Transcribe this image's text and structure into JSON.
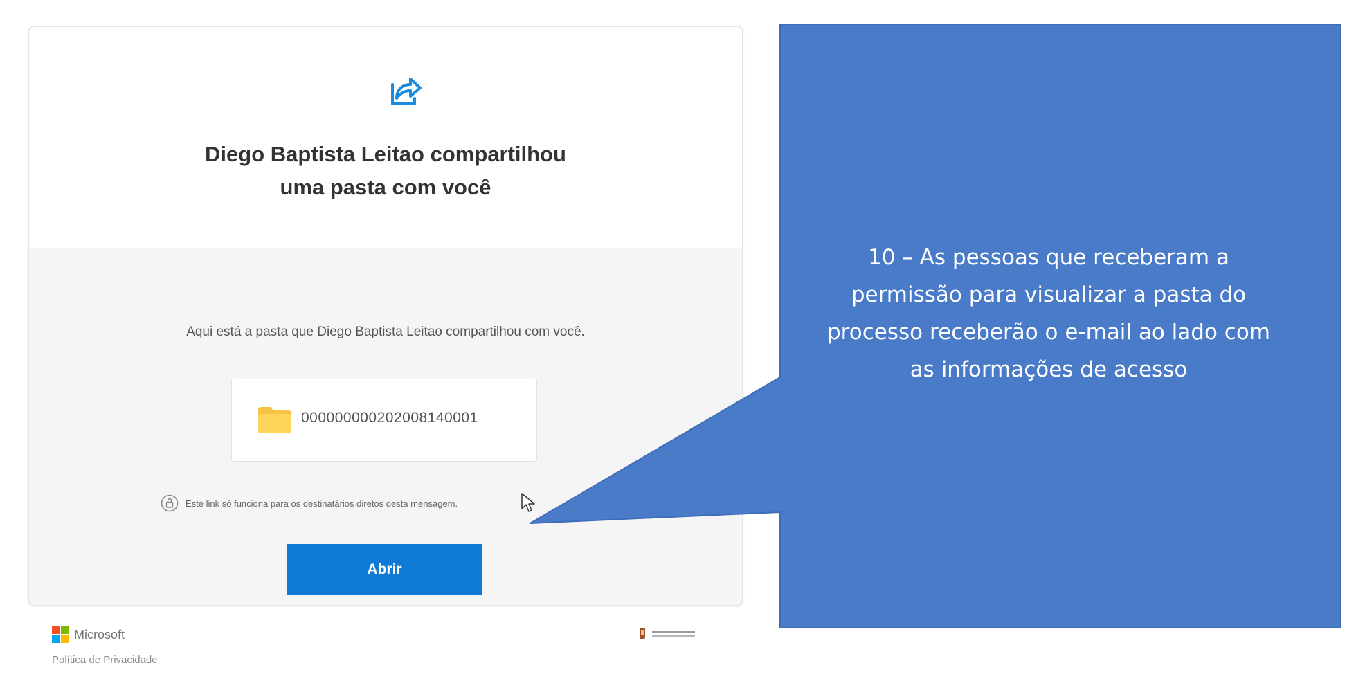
{
  "email": {
    "title_line1": "Diego Baptista Leitao compartilhou",
    "title_line2": "uma pasta com você",
    "message": "Aqui está a pasta que Diego Baptista Leitao compartilhou com você.",
    "folder_name": "000000000202008140001",
    "link_note": "Este link só funciona para os destinatários diretos desta mensagem.",
    "open_button_label": "Abrir"
  },
  "footer": {
    "brand_name": "Microsoft",
    "privacy_link": "Política de Privacidade"
  },
  "callout": {
    "line1": "10 – As pessoas que receberam a",
    "line2": "permissão para visualizar a pasta do",
    "line3": "processo receberão o e-mail ao lado com",
    "line4": "as informações de acesso"
  },
  "colors": {
    "callout_fill": "#4a7bc8",
    "callout_stroke": "#3e6db5",
    "button": "#0f7ad6",
    "accent_icon": "#1a8ae0",
    "folder": "#f6c343"
  },
  "icons": {
    "share": "share-icon",
    "folder": "folder-icon",
    "lock": "lock-icon",
    "cursor": "cursor-icon",
    "microsoft_logo": "microsoft-logo-icon"
  }
}
